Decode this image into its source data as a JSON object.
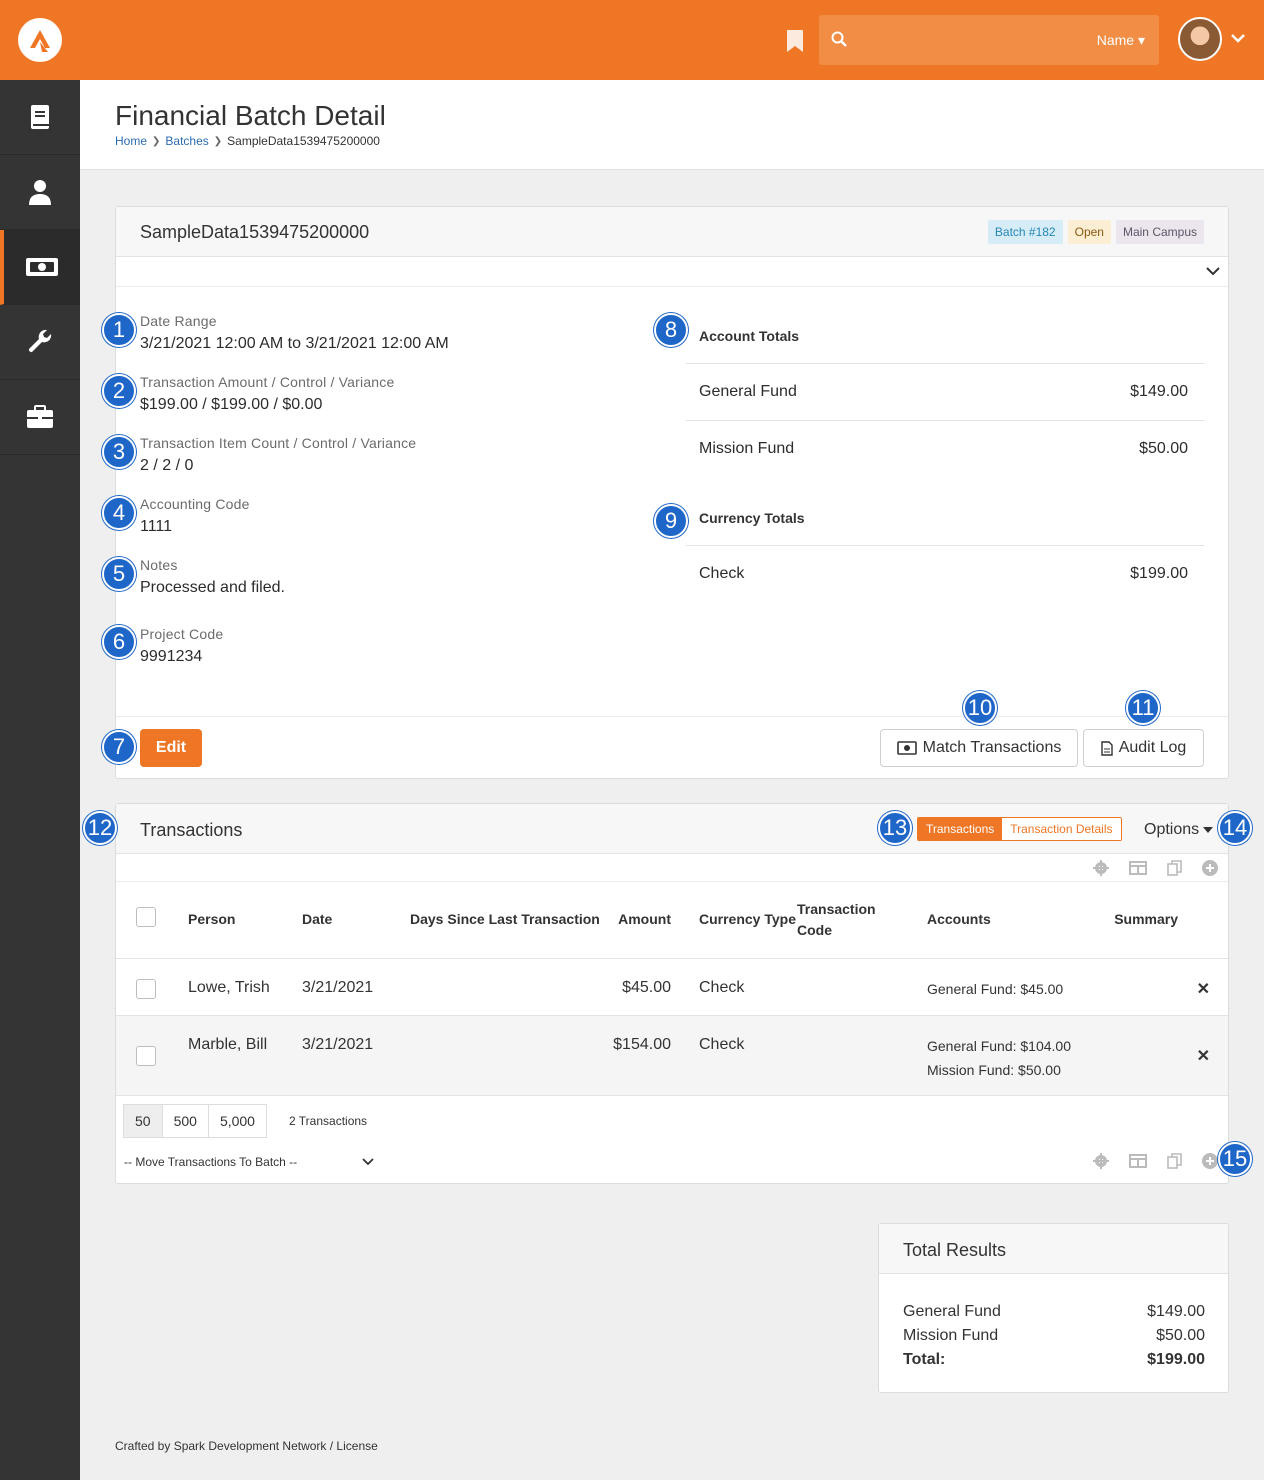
{
  "header": {
    "search": {
      "placeholder": "",
      "filter_label": "Name"
    }
  },
  "page": {
    "title": "Financial Batch Detail",
    "breadcrumb": [
      "Home",
      "Batches",
      "SampleData1539475200000"
    ]
  },
  "batch": {
    "title": "SampleData1539475200000",
    "labels": {
      "batch": "Batch #182",
      "status": "Open",
      "campus": "Main Campus"
    },
    "fields": [
      {
        "label": "Date Range",
        "value": "3/21/2021 12:00 AM to 3/21/2021 12:00 AM"
      },
      {
        "label": "Transaction Amount / Control / Variance",
        "value": "$199.00 / $199.00 / $0.00"
      },
      {
        "label": "Transaction Item Count / Control / Variance",
        "value": "2 / 2 / 0"
      },
      {
        "label": "Accounting Code",
        "value": "1111"
      },
      {
        "label": "Notes",
        "value": "Processed and filed."
      },
      {
        "label": "Project Code",
        "value": "9991234"
      }
    ],
    "account_totals": {
      "heading": "Account Totals",
      "rows": [
        {
          "name": "General Fund",
          "amount": "$149.00"
        },
        {
          "name": "Mission Fund",
          "amount": "$50.00"
        }
      ]
    },
    "currency_totals": {
      "heading": "Currency Totals",
      "rows": [
        {
          "name": "Check",
          "amount": "$199.00"
        }
      ]
    },
    "buttons": {
      "edit": "Edit",
      "match": "Match Transactions",
      "audit": "Audit Log"
    }
  },
  "transactions": {
    "title": "Transactions",
    "toggle": {
      "active": "Transactions",
      "inactive": "Transaction Details"
    },
    "options_label": "Options",
    "columns": [
      "Person",
      "Date",
      "Days Since Last Transaction",
      "Amount",
      "Currency Type",
      "Transaction Code",
      "Accounts",
      "Summary"
    ],
    "rows": [
      {
        "person": "Lowe, Trish",
        "date": "3/21/2021",
        "days": "",
        "amount": "$45.00",
        "currency": "Check",
        "code": "",
        "accounts": [
          "General Fund: $45.00"
        ],
        "summary": ""
      },
      {
        "person": "Marble, Bill",
        "date": "3/21/2021",
        "days": "",
        "amount": "$154.00",
        "currency": "Check",
        "code": "",
        "accounts": [
          "General Fund: $104.00",
          "Mission Fund: $50.00"
        ],
        "summary": ""
      }
    ],
    "page_sizes": [
      "50",
      "500",
      "5,000"
    ],
    "count_label": "2 Transactions",
    "move_label": "-- Move Transactions To Batch --"
  },
  "total_results": {
    "title": "Total Results",
    "rows": [
      {
        "name": "General Fund",
        "amount": "$149.00"
      },
      {
        "name": "Mission Fund",
        "amount": "$50.00"
      }
    ],
    "total": {
      "name": "Total:",
      "amount": "$199.00"
    }
  },
  "footer": {
    "text": "Crafted by Spark Development Network / License"
  },
  "callouts": [
    "1",
    "2",
    "3",
    "4",
    "5",
    "6",
    "7",
    "8",
    "9",
    "10",
    "11",
    "12",
    "13",
    "14",
    "15"
  ],
  "colors": {
    "brand": "#ee7624",
    "sidebar": "#343434",
    "callout": "#1f66c9",
    "link": "#2b6cb0"
  }
}
